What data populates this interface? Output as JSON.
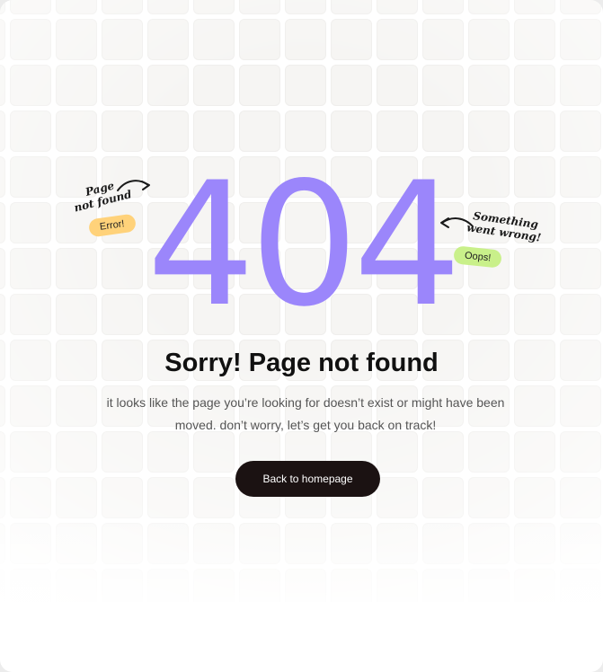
{
  "error_code": "404",
  "annotations": {
    "left_note_line1": "Page",
    "left_note_line2": "not found",
    "left_badge": "Error!",
    "right_note_line1": "Something",
    "right_note_line2": "went wrong!",
    "right_badge": "Oops!"
  },
  "heading": "Sorry! Page not found",
  "description": "it looks like the page you’re looking for doesn’t exist or might have been moved. don’t worry, let’s get you back on track!",
  "cta": {
    "label": "Back to homepage"
  },
  "colors": {
    "accent": "#9b86fb",
    "button_bg": "#1b1212",
    "badge_error": "#ffd27a",
    "badge_oops": "#c9f08a"
  }
}
